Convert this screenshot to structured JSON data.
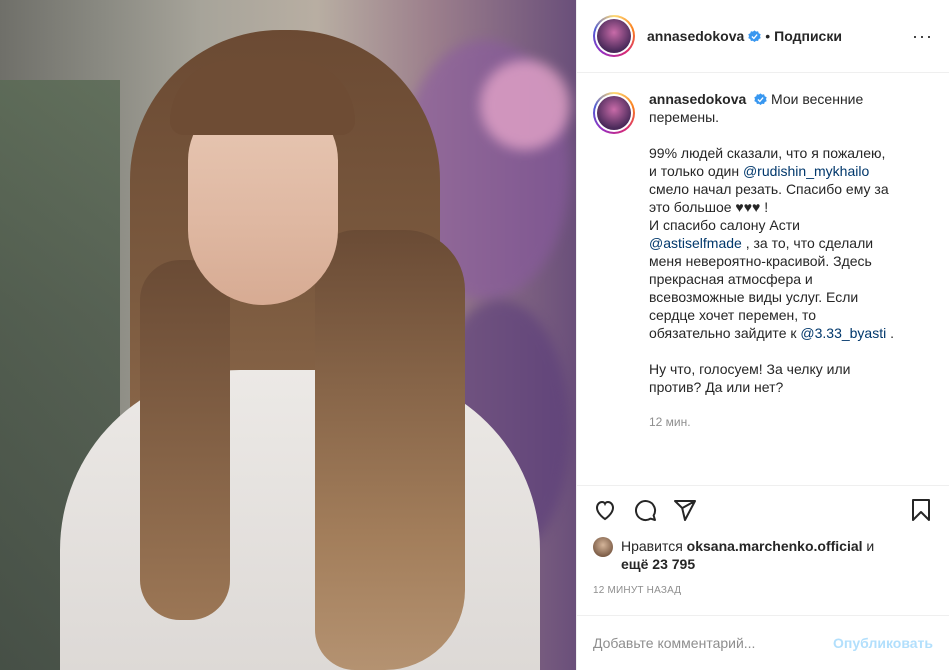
{
  "post": {
    "username": "annasedokova",
    "follow_label": "Подписки",
    "dot": "•",
    "more": "···"
  },
  "caption": {
    "username": "annasedokova",
    "line1": "Мои весенние",
    "line2": "перемены.",
    "p2_1": "99% людей сказали, что я пожалею,",
    "p2_2": "и только один",
    "mention1": "@rudishin_mykhailo",
    "p2_3": "смело начал резать. Спасибо ему за",
    "p2_4": "это большое ♥♥♥ !",
    "p2_5": "И спасибо салону Асти",
    "mention2": "@astiselfmade",
    "p2_6": ", за то, что сделали",
    "p2_7": "меня невероятно-красивой. Здесь",
    "p2_8": "прекрасная атмосфера и",
    "p2_9": "всевозможные виды услуг. Если",
    "p2_10": "сердце хочет перемен, то",
    "p2_11": "обязательно зайдите к",
    "mention3": "@3.33_byasti",
    "p2_12": ".",
    "p3_1": "Ну что, голосуем! За челку или",
    "p3_2": "против? Да или нет?",
    "time": "12 мин."
  },
  "likes": {
    "prefix": "Нравится",
    "user": "oksana.marchenko.official",
    "and": "и",
    "more_prefix": "ещё",
    "count": "23 795"
  },
  "posted_ago": "12 МИНУТ НАЗАД",
  "comment": {
    "placeholder": "Добавьте комментарий...",
    "publish": "Опубликовать"
  },
  "colors": {
    "link": "#00376b",
    "muted": "#8e8e8e",
    "publish_disabled": "#b2dffc",
    "verified": "#3897f0"
  }
}
